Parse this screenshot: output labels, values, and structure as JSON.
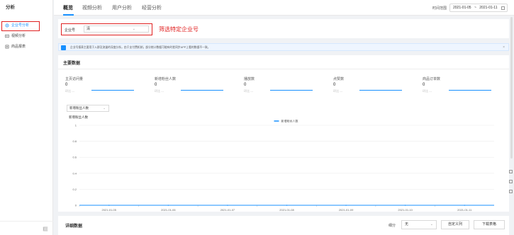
{
  "sidebar": {
    "title": "分析",
    "items": [
      {
        "label": "企业号分析",
        "icon": "settings-icon",
        "active": true
      },
      {
        "label": "视频分析",
        "icon": "video-icon",
        "active": false
      },
      {
        "label": "商品报表",
        "icon": "report-icon",
        "active": false
      }
    ],
    "collapse_icon": "collapse-icon"
  },
  "header": {
    "tabs": [
      {
        "label": "概览",
        "active": true
      },
      {
        "label": "视频分析",
        "active": false
      },
      {
        "label": "用户分析",
        "active": false
      },
      {
        "label": "经营分析",
        "active": false
      }
    ],
    "time_label": "时间范围",
    "date_start": "2021-01-05",
    "date_sep": "~",
    "date_end": "2021-01-11"
  },
  "filter": {
    "label": "企业号",
    "value": "清",
    "annotation": "筛选特定企业号"
  },
  "notice": {
    "text": "企业号报表主要用于入群及流量的深度分析，由于支付费机制，部分统计数据可能有时差同步APP上看的数据不一致。",
    "close": "×"
  },
  "main_data": {
    "title": "主要数据",
    "metrics": [
      {
        "label": "主页访问量",
        "value": "0",
        "sub": "环比 ---"
      },
      {
        "label": "新增粉丝人数",
        "value": "0",
        "sub": "环比 ---"
      },
      {
        "label": "播放数",
        "value": "0",
        "sub": "环比 ---"
      },
      {
        "label": "点赞数",
        "value": "0",
        "sub": "环比 ---"
      },
      {
        "label": "商品订单数",
        "value": "0",
        "sub": "环比 ---"
      }
    ],
    "metric_select": "新增粉丝人数"
  },
  "chart_data": {
    "type": "line",
    "title": "新增粉丝人数",
    "xlabel": "",
    "ylabel": "新增粉丝人数",
    "categories": [
      "2021-01-05",
      "2021-01-06",
      "2021-01-07",
      "2021-01-08",
      "2021-01-09",
      "2021-01-10",
      "2021-01-11"
    ],
    "series": [
      {
        "name": "新增粉丝人数",
        "values": [
          0,
          0,
          0,
          0,
          0,
          0,
          0
        ],
        "color": "#1890ff"
      }
    ],
    "y_ticks": [
      "0",
      "0.2",
      "0.4",
      "0.6",
      "0.8",
      "1"
    ],
    "ylim": [
      0,
      1
    ],
    "grid": true,
    "legend_position": "top-center"
  },
  "detail": {
    "title": "详细数据",
    "group_label": "细分",
    "group_value": "无",
    "custom_columns": "自定义列",
    "download": "下载表格"
  },
  "colors": {
    "accent": "#1890ff",
    "highlight": "#e02020"
  }
}
